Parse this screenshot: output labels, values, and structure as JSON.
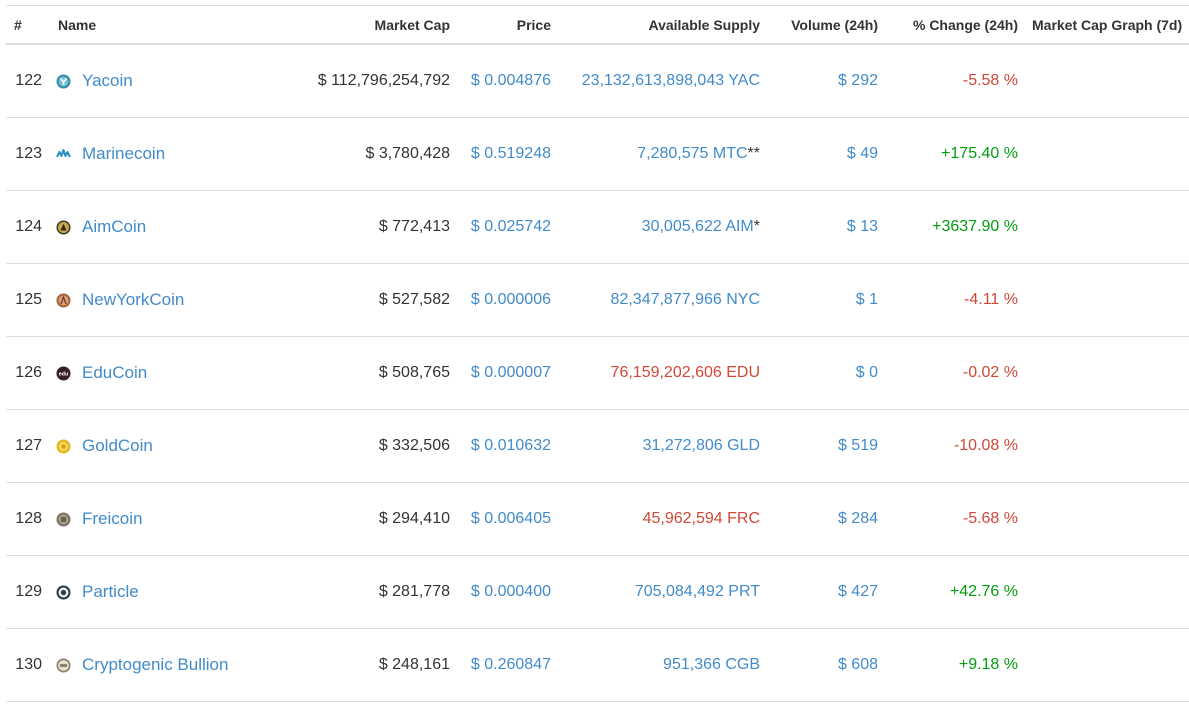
{
  "header": {
    "rank": "#",
    "name": "Name",
    "market_cap": "Market Cap",
    "price": "Price",
    "supply": "Available Supply",
    "volume": "Volume (24h)",
    "change": "% Change (24h)",
    "graph": "Market Cap Graph (7d)"
  },
  "rows": [
    {
      "rank": "122",
      "name": "Yacoin",
      "icon": "yacoin-icon",
      "market_cap": "$ 112,796,254,792",
      "price": "$ 0.004876",
      "supply": "23,132,613,898,043 YAC",
      "supply_color": "link",
      "volume": "$ 292",
      "change": "-5.58 %",
      "change_dir": "neg"
    },
    {
      "rank": "123",
      "name": "Marinecoin",
      "icon": "marinecoin-icon",
      "market_cap": "$ 3,780,428",
      "price": "$ 0.519248",
      "supply": "7,280,575 MTC",
      "supply_suffix": "**",
      "supply_color": "link",
      "volume": "$ 49",
      "change": "+175.40 %",
      "change_dir": "pos"
    },
    {
      "rank": "124",
      "name": "AimCoin",
      "icon": "aimcoin-icon",
      "market_cap": "$ 772,413",
      "price": "$ 0.025742",
      "supply": "30,005,622 AIM",
      "supply_suffix": "*",
      "supply_color": "link",
      "volume": "$ 13",
      "change": "+3637.90 %",
      "change_dir": "pos"
    },
    {
      "rank": "125",
      "name": "NewYorkCoin",
      "icon": "newyorkcoin-icon",
      "market_cap": "$ 527,582",
      "price": "$ 0.000006",
      "supply": "82,347,877,966 NYC",
      "supply_color": "link",
      "volume": "$ 1",
      "change": "-4.11 %",
      "change_dir": "neg"
    },
    {
      "rank": "126",
      "name": "EduCoin",
      "icon": "educoin-icon",
      "icon_text": "edu",
      "market_cap": "$ 508,765",
      "price": "$ 0.000007",
      "supply": "76,159,202,606 EDU",
      "supply_color": "neg",
      "volume": "$ 0",
      "change": "-0.02 %",
      "change_dir": "neg"
    },
    {
      "rank": "127",
      "name": "GoldCoin",
      "icon": "goldcoin-icon",
      "market_cap": "$ 332,506",
      "price": "$ 0.010632",
      "supply": "31,272,806 GLD",
      "supply_color": "link",
      "volume": "$ 519",
      "change": "-10.08 %",
      "change_dir": "neg"
    },
    {
      "rank": "128",
      "name": "Freicoin",
      "icon": "freicoin-icon",
      "market_cap": "$ 294,410",
      "price": "$ 0.006405",
      "supply": "45,962,594 FRC",
      "supply_color": "neg",
      "volume": "$ 284",
      "change": "-5.68 %",
      "change_dir": "neg"
    },
    {
      "rank": "129",
      "name": "Particle",
      "icon": "particle-icon",
      "market_cap": "$ 281,778",
      "price": "$ 0.000400",
      "supply": "705,084,492 PRT",
      "supply_color": "link",
      "volume": "$ 427",
      "change": "+42.76 %",
      "change_dir": "pos"
    },
    {
      "rank": "130",
      "name": "Cryptogenic Bullion",
      "icon": "cryptogenic-bullion-icon",
      "market_cap": "$ 248,161",
      "price": "$ 0.260847",
      "supply": "951,366 CGB",
      "supply_color": "link",
      "volume": "$ 608",
      "change": "+9.18 %",
      "change_dir": "pos"
    }
  ],
  "colors": {
    "link": "#428bca",
    "negative": "#d14836",
    "positive": "#009e0f",
    "text": "#333333",
    "border": "#dddddd"
  }
}
